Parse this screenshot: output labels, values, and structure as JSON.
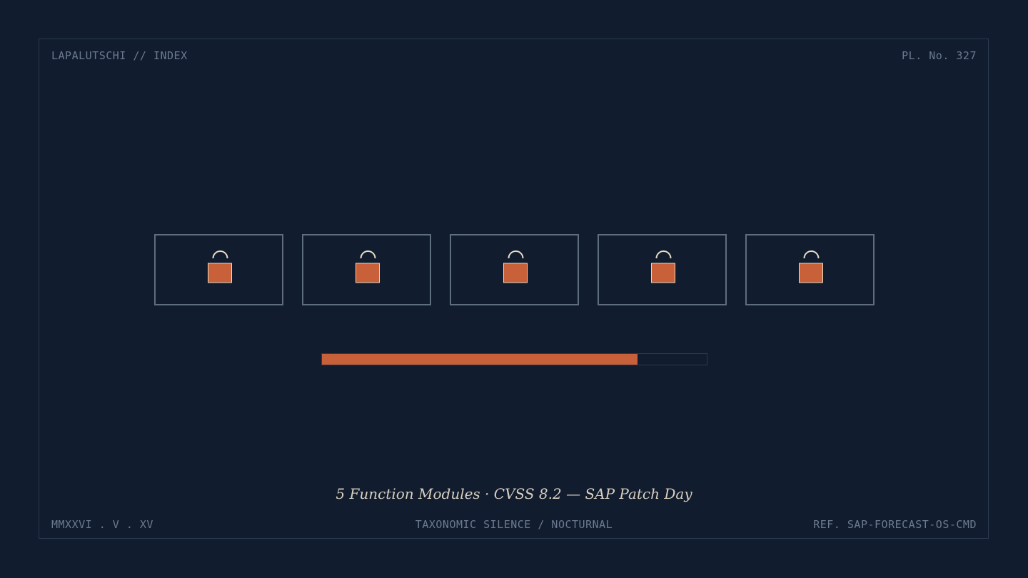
{
  "header": {
    "left_label": "LAPALUTSCHI // INDEX",
    "right_label": "PL. No. 327"
  },
  "modules": {
    "count": 5,
    "icon": "lock-icon",
    "items": [
      {
        "icon": "lock-icon"
      },
      {
        "icon": "lock-icon"
      },
      {
        "icon": "lock-icon"
      },
      {
        "icon": "lock-icon"
      },
      {
        "icon": "lock-icon"
      }
    ]
  },
  "progress": {
    "fraction": 0.82
  },
  "caption": "5 Function Modules · CVSS 8.2 — SAP Patch Day",
  "footer": {
    "left_label": "MMXXVI . V . XV",
    "center_label": "TAXONOMIC SILENCE / NOCTURNAL",
    "right_label": "REF. SAP-FORECAST-OS-CMD"
  },
  "colors": {
    "background": "#111c2e",
    "accent": "#c8613a",
    "shackle": "#e8dcc4",
    "module_border": "#5f6d80",
    "muted_text": "#6b7a90",
    "caption_text": "#d8cfbf"
  }
}
